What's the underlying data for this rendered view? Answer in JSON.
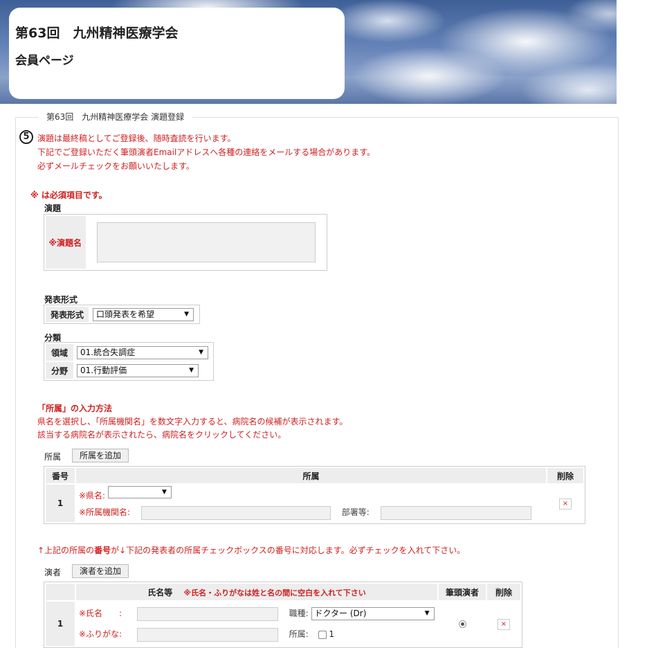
{
  "header": {
    "title": "第63回　九州精神医療学会",
    "subtitle": "会員ページ"
  },
  "form": {
    "legend": "第63回　九州精神医療学会 演題登録",
    "step_number": "5",
    "notice_lines": [
      "演題は最終稿としてご登録後、随時査読を行います。",
      "下記でご登録いただく筆頭演者Emailアドレスへ各種の連絡をメールする場合があります。",
      "必ずメールチェックをお願いいたします。"
    ],
    "required_note": "※ は必須項目です。"
  },
  "title_section": {
    "label": "演題",
    "field_label": "※演題名",
    "value": ""
  },
  "format_section": {
    "label": "発表形式",
    "field_label": "発表形式",
    "selected": "口頭発表を希望"
  },
  "category_section": {
    "label": "分類",
    "domain_label": "領域",
    "domain_selected": "01.統合失調症",
    "field_label": "分野",
    "field_selected": "01.行動評価"
  },
  "affiliation_help": {
    "title": "「所属」の入力方法",
    "lines": [
      "県名を選択し、「所属機関名」を数文字入力すると、病院名の候補が表示されます。",
      "該当する病院名が表示されたら、病院名をクリックしてください。"
    ]
  },
  "affiliation": {
    "label": "所属",
    "add_button": "所属を追加",
    "columns": [
      "番号",
      "所属",
      "削除"
    ],
    "rows": [
      {
        "number": "1",
        "pref_label": "※県名:",
        "pref_selected": "",
        "org_label": "※所属機関名:",
        "org_value": "",
        "dept_label": "部署等:",
        "dept_value": "",
        "delete": "×"
      }
    ]
  },
  "link_note": {
    "prefix": "↑上記の所属の",
    "bold": "番号",
    "suffix": "が↓下記の発表者の所属チェックボックスの番号に対応します。必ずチェックを入れて下さい。"
  },
  "presenters": {
    "label": "演者",
    "add_button": "演者を追加",
    "columns": {
      "name": "氏名等",
      "name_note": "※氏名・ふりがなは姓と名の間に空白を入れて下さい",
      "first_author": "筆頭演者",
      "delete": "削除"
    },
    "rows": [
      {
        "number": "1",
        "name_label": "※氏名　　:",
        "name_value": "",
        "kana_label": "※ふりがな:",
        "kana_value": "",
        "job_label": "職種:",
        "job_selected": "ドクター (Dr)",
        "aff_label": "所属:",
        "aff_option": "1",
        "delete": "×"
      }
    ]
  }
}
